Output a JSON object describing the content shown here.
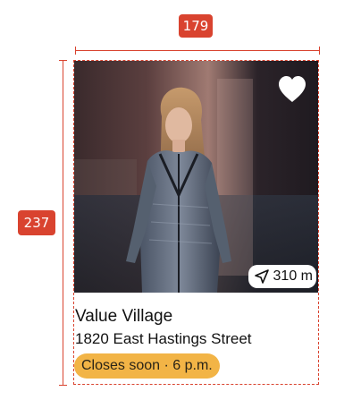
{
  "redline": {
    "width_label": "179",
    "height_label": "237"
  },
  "card": {
    "name": "Value Village",
    "address": "1820 East Hastings Street",
    "status": "Closes soon · 6 p.m.",
    "distance": "310 m",
    "favorite_icon": "heart-icon",
    "distance_icon": "navigation-arrow-icon"
  },
  "colors": {
    "redline": "#d9432f",
    "status_badge": "#f2b446",
    "text": "#111111"
  }
}
